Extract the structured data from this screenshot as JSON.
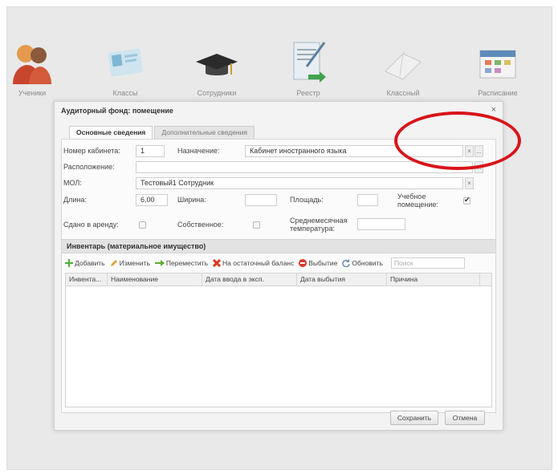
{
  "app_nav": {
    "items": [
      {
        "label": "Ученики",
        "icon": "students-icon"
      },
      {
        "label": "Классы",
        "icon": "classes-icon"
      },
      {
        "label": "Сотрудники",
        "icon": "staff-icon"
      },
      {
        "label": "Реестр",
        "icon": "registry-icon"
      },
      {
        "label": "Классный",
        "icon": "class-journal-icon"
      },
      {
        "label": "Расписание",
        "icon": "schedule-icon"
      }
    ]
  },
  "dialog": {
    "title": "Аудиторный фонд: помещение",
    "close_glyph": "×",
    "tabs": [
      {
        "label": "Основные сведения",
        "active": true
      },
      {
        "label": "Дополнительные сведения",
        "active": false
      }
    ],
    "form": {
      "room_number_label": "Номер кабинета:",
      "room_number_value": "1",
      "purpose_label": "Назначение:",
      "purpose_value": "Кабинет иностранного языка",
      "location_label": "Расположение:",
      "location_value": "",
      "mol_label": "МОЛ:",
      "mol_value": "Тестовый1 Сотрудник",
      "length_label": "Длина:",
      "length_value": "6,00",
      "width_label": "Ширина:",
      "width_value": "",
      "area_label": "Площадь:",
      "area_value": "",
      "educational_label_line1": "Учебное",
      "educational_label_line2": "помещение:",
      "educational_checked": true,
      "rented_label": "Сдано в аренду:",
      "rented_checked": false,
      "own_label": "Собственное:",
      "own_checked": false,
      "avg_temp_label_line1": "Среднемесячная",
      "avg_temp_label_line2": "температура:",
      "avg_temp_value": "",
      "clear_glyph": "×",
      "more_glyph": "..."
    },
    "inventory": {
      "title": "Инвентарь (материальное имущество)",
      "toolbar": {
        "add": "Добавить",
        "edit": "Изменить",
        "move": "Переместить",
        "residual": "На остаточный баланс",
        "disposal": "Выбытие",
        "refresh": "Обновить",
        "search_placeholder": "Поиск"
      },
      "columns": [
        "Инвента...",
        "Наименование",
        "Дата ввода в эксп.",
        "Дата выбытия",
        "Причина"
      ],
      "rows": []
    },
    "buttons": {
      "save": "Сохранить",
      "cancel": "Отмена"
    }
  },
  "colors": {
    "highlight": "#d8141a",
    "add_icon": "#4caf3a",
    "move_icon": "#5cab2e",
    "residual_icon": "#d93a1e",
    "disposal_icon": "#d93a2a"
  }
}
